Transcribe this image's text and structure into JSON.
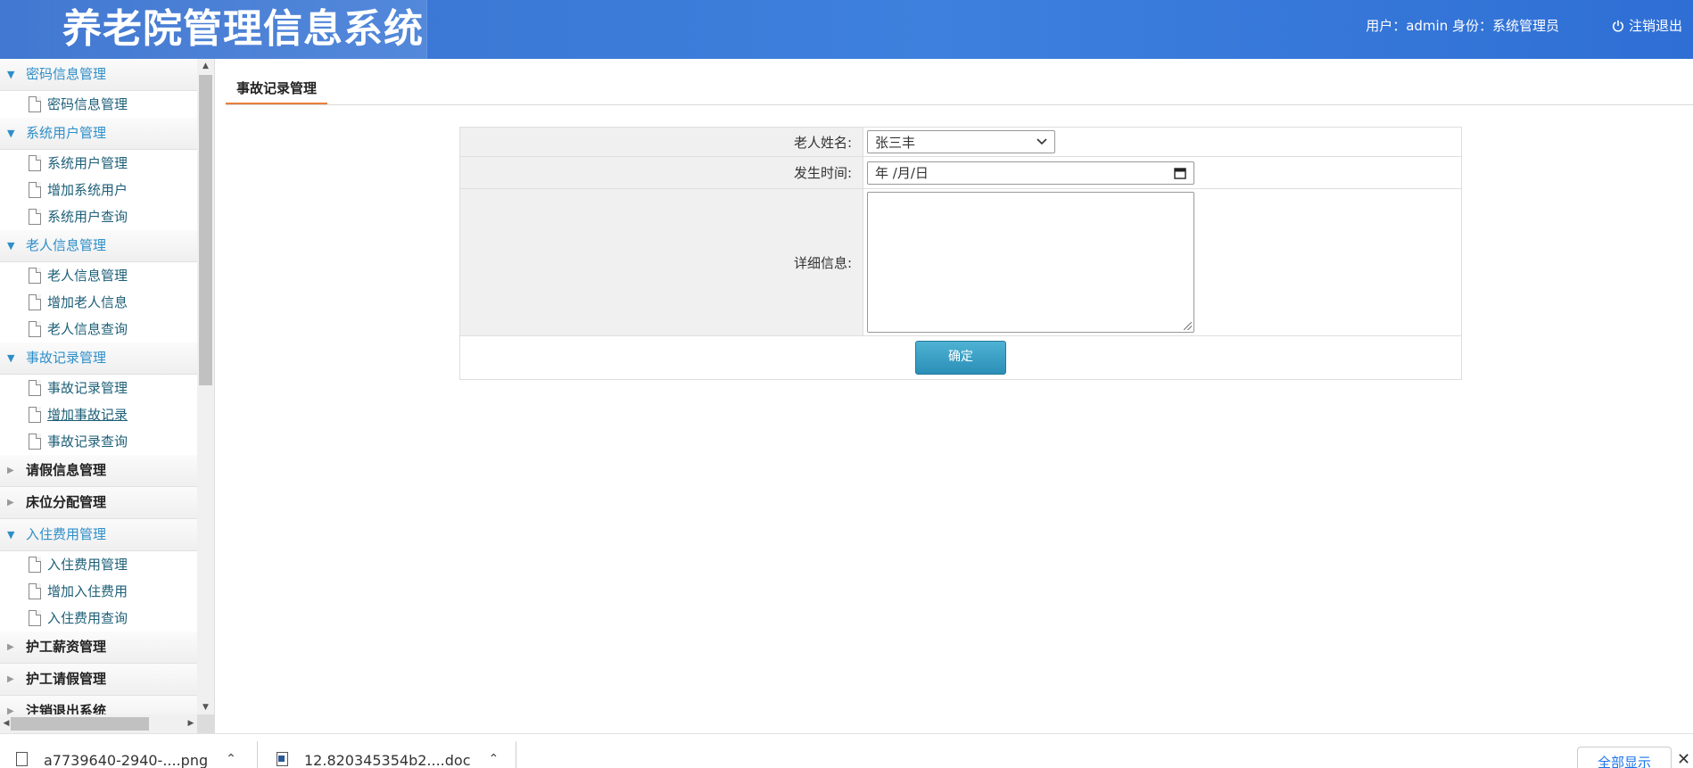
{
  "header": {
    "title": "养老院管理信息系统",
    "user_info": "用户：admin 身份：系统管理员",
    "logout_label": "注销退出"
  },
  "sidebar": {
    "groups": [
      {
        "label": "密码信息管理",
        "state": "open",
        "items": [
          "密码信息管理"
        ]
      },
      {
        "label": "系统用户管理",
        "state": "open",
        "items": [
          "系统用户管理",
          "增加系统用户",
          "系统用户查询"
        ]
      },
      {
        "label": "老人信息管理",
        "state": "open",
        "items": [
          "老人信息管理",
          "增加老人信息",
          "老人信息查询"
        ]
      },
      {
        "label": "事故记录管理",
        "state": "open",
        "items": [
          "事故记录管理",
          "增加事故记录",
          "事故记录查询"
        ]
      },
      {
        "label": "请假信息管理",
        "state": "closed",
        "items": []
      },
      {
        "label": "床位分配管理",
        "state": "closed",
        "items": []
      },
      {
        "label": "入住费用管理",
        "state": "open",
        "items": [
          "入住费用管理",
          "增加入住费用",
          "入住费用查询"
        ]
      },
      {
        "label": "护工薪资管理",
        "state": "closed",
        "items": []
      },
      {
        "label": "护工请假管理",
        "state": "closed",
        "items": []
      },
      {
        "label": "注销退出系统",
        "state": "closed",
        "items": []
      }
    ]
  },
  "main": {
    "tab_label": "事故记录管理",
    "form": {
      "elder_name_label": "老人姓名:",
      "elder_name_value": "张三丰",
      "time_label": "发生时间:",
      "time_placeholder": "年 /月/日",
      "detail_label": "详细信息:",
      "submit_label": "确定"
    }
  },
  "download_bar": {
    "items": [
      {
        "name": "a7739640-2940-....png",
        "icon": "image-file-icon"
      },
      {
        "name": "12.820345354b2....doc",
        "icon": "word-file-icon"
      }
    ],
    "show_all_label": "全部显示"
  },
  "colors": {
    "header_blue": "#3d80dd",
    "menu_open_text": "#2e8ec9",
    "tab_underline": "#e87f3c",
    "button_teal": "#2b8fb7"
  }
}
